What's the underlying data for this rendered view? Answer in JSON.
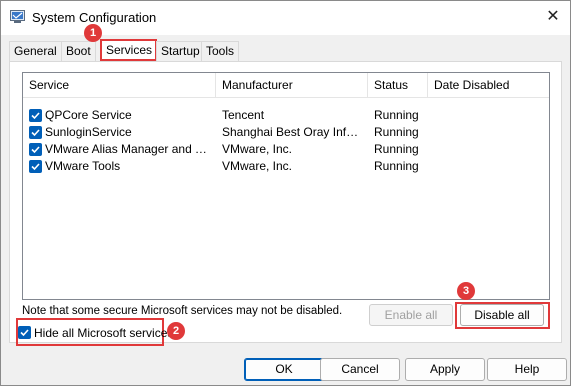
{
  "window": {
    "title": "System Configuration",
    "close_glyph": "✕",
    "app_icon": "system-config-icon"
  },
  "tabs": [
    {
      "label": "General",
      "active": false
    },
    {
      "label": "Boot",
      "active": false
    },
    {
      "label": "Services",
      "active": true
    },
    {
      "label": "Startup",
      "active": false
    },
    {
      "label": "Tools",
      "active": false
    }
  ],
  "services": {
    "columns": [
      "Service",
      "Manufacturer",
      "Status",
      "Date Disabled"
    ],
    "rows": [
      {
        "checked": true,
        "service": "QPCore Service",
        "manufacturer": "Tencent",
        "status": "Running",
        "date_disabled": ""
      },
      {
        "checked": true,
        "service": "SunloginService",
        "manufacturer": "Shanghai Best Oray Infor...",
        "status": "Running",
        "date_disabled": ""
      },
      {
        "checked": true,
        "service": "VMware Alias Manager and Ticke...",
        "manufacturer": "VMware, Inc.",
        "status": "Running",
        "date_disabled": ""
      },
      {
        "checked": true,
        "service": "VMware Tools",
        "manufacturer": "VMware, Inc.",
        "status": "Running",
        "date_disabled": ""
      }
    ],
    "note": "Note that some secure Microsoft services may not be disabled.",
    "enable_all_label": "Enable all",
    "disable_all_label": "Disable all",
    "hide_ms_label": "Hide all Microsoft services",
    "hide_ms_checked": true
  },
  "annotations": [
    "1",
    "2",
    "3"
  ],
  "footer": {
    "ok": "OK",
    "cancel": "Cancel",
    "apply": "Apply",
    "help": "Help"
  },
  "colors": {
    "accent": "#005fb8",
    "highlight": "#e0393a"
  }
}
